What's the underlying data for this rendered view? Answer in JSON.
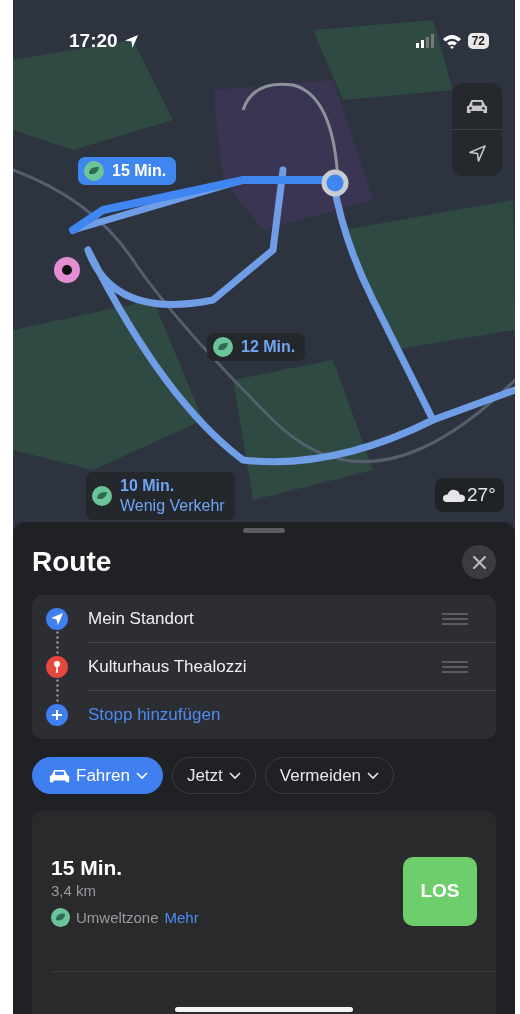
{
  "status_bar": {
    "time": "17:20",
    "battery": "72"
  },
  "map": {
    "route_labels": [
      {
        "duration": "15 Min.",
        "selected": true
      },
      {
        "duration": "12 Min.",
        "selected": false
      },
      {
        "duration": "10 Min.",
        "note": "Wenig Verkehr",
        "selected": false
      }
    ],
    "weather": {
      "temperature": "27°"
    }
  },
  "sheet": {
    "title": "Route",
    "stops": [
      {
        "kind": "origin",
        "name": "Mein Standort"
      },
      {
        "kind": "destination",
        "name": "Kulturhaus Thealozzi"
      },
      {
        "kind": "add",
        "name": "Stopp hinzufügen"
      }
    ],
    "options": [
      {
        "label": "Fahren",
        "selected": true
      },
      {
        "label": "Jetzt",
        "selected": false
      },
      {
        "label": "Vermeiden",
        "selected": false
      }
    ],
    "routes": [
      {
        "duration": "15 Min.",
        "distance": "3,4 km",
        "zone": "Umweltzone",
        "more": "Mehr",
        "go": "LOS"
      }
    ]
  }
}
